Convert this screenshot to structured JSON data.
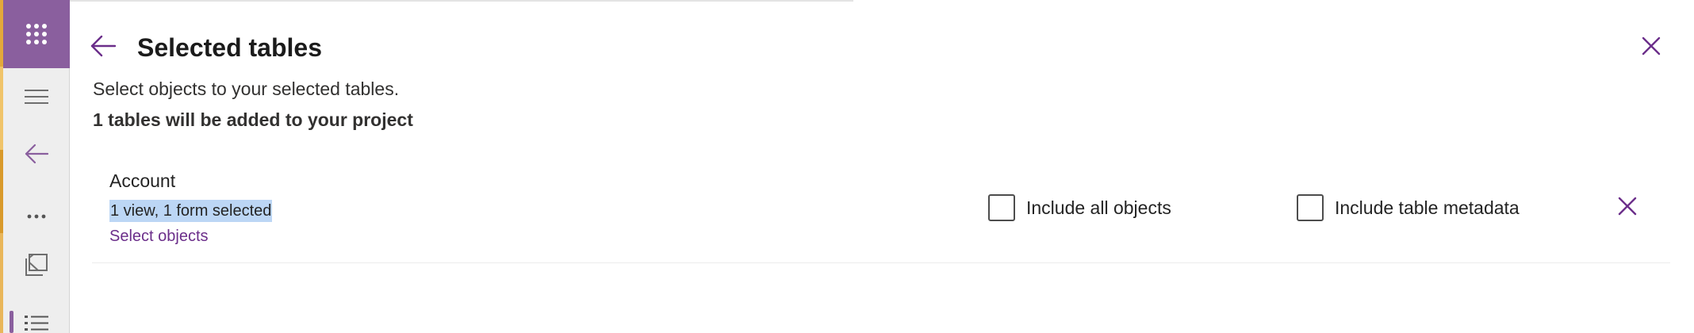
{
  "rail": {
    "icons": [
      "waffle-icon",
      "hamburger-icon",
      "back-arrow-icon",
      "more-icon",
      "page-icon",
      "list-icon"
    ]
  },
  "panel": {
    "title": "Selected tables",
    "description": "Select objects to your selected tables.",
    "summary": "1 tables will be added to your project"
  },
  "tables": [
    {
      "name": "Account",
      "selection": "1 view, 1 form selected",
      "select_link": "Select objects",
      "include_all_label": "Include all objects",
      "include_all_checked": false,
      "include_metadata_label": "Include table metadata",
      "include_metadata_checked": false
    }
  ],
  "colors": {
    "accent": "#8a5f9e",
    "link": "#6b2e8a",
    "highlight": "#bcd6f5"
  }
}
